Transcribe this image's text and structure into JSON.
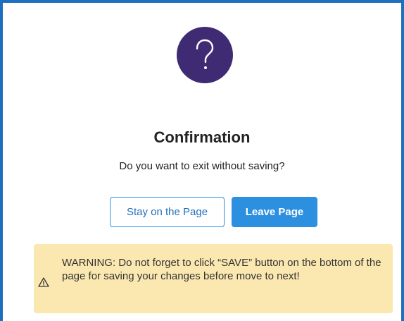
{
  "dialog": {
    "icon": "question-mark-icon",
    "title": "Confirmation",
    "message": "Do you want to exit without saving?",
    "stay_label": "Stay on the Page",
    "leave_label": "Leave Page",
    "warning": {
      "icon": "warning-triangle-icon",
      "text": "WARNING: Do not forget to click “SAVE” button on the bottom of the page for saving your changes before move to next!"
    }
  },
  "colors": {
    "frame_border": "#1f6fbf",
    "icon_circle": "#3f2b73",
    "primary": "#2d8fe0",
    "warning_bg": "#fbe8b0"
  }
}
